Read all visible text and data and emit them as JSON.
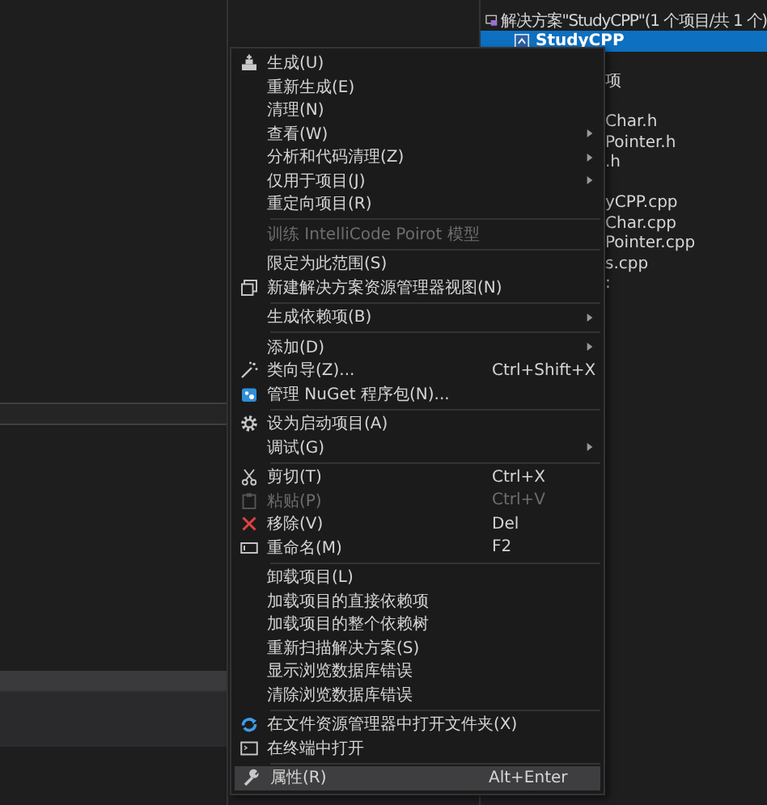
{
  "solution_explorer": {
    "solution_row": "解决方案\"StudyCPP\"(1 个项目/共 1 个)",
    "project_row": {
      "label": "StudyCPP",
      "selected": true
    },
    "visible_fragments": [
      [
        "项"
      ],
      [
        "Char.h",
        "Pointer.h",
        ".h"
      ],
      [
        "yCPP.cpp",
        "Char.cpp",
        "Pointer.cpp",
        "s.cpp",
        ":"
      ]
    ]
  },
  "context_menu": [
    [
      {
        "label": "生成(U)"
      },
      {
        "label": "重新生成(E)"
      },
      {
        "label": "清理(N)"
      },
      {
        "label": "查看(W)",
        "submenu": true
      },
      {
        "label": "分析和代码清理(Z)",
        "submenu": true
      },
      {
        "label": "仅用于项目(J)",
        "submenu": true
      },
      {
        "label": "重定向项目(R)"
      }
    ],
    [
      {
        "label": "训练 IntelliCode Poirot 模型",
        "disabled": true
      }
    ],
    [
      {
        "label": "限定为此范围(S)"
      },
      {
        "label": "新建解决方案资源管理器视图(N)"
      }
    ],
    [
      {
        "label": "生成依赖项(B)",
        "submenu": true
      }
    ],
    [
      {
        "label": "添加(D)",
        "submenu": true
      },
      {
        "label": "类向导(Z)...",
        "shortcut": "Ctrl+Shift+X"
      },
      {
        "label": "管理 NuGet 程序包(N)..."
      }
    ],
    [
      {
        "label": "设为启动项目(A)"
      },
      {
        "label": "调试(G)",
        "submenu": true
      }
    ],
    [
      {
        "label": "剪切(T)",
        "shortcut": "Ctrl+X"
      },
      {
        "label": "粘贴(P)",
        "shortcut": "Ctrl+V",
        "disabled": true
      },
      {
        "label": "移除(V)",
        "shortcut": "Del"
      },
      {
        "label": "重命名(M)",
        "shortcut": "F2"
      }
    ],
    [
      {
        "label": "卸载项目(L)"
      },
      {
        "label": "加载项目的直接依赖项"
      },
      {
        "label": "加载项目的整个依赖树"
      },
      {
        "label": "重新扫描解决方案(S)"
      },
      {
        "label": "显示浏览数据库错误"
      },
      {
        "label": "清除浏览数据库错误"
      }
    ],
    [
      {
        "label": "在文件资源管理器中打开文件夹(X)"
      },
      {
        "label": "在终端中打开"
      }
    ],
    [
      {
        "label": "属性(R)",
        "shortcut": "Alt+Enter",
        "highlighted": true
      }
    ]
  ]
}
